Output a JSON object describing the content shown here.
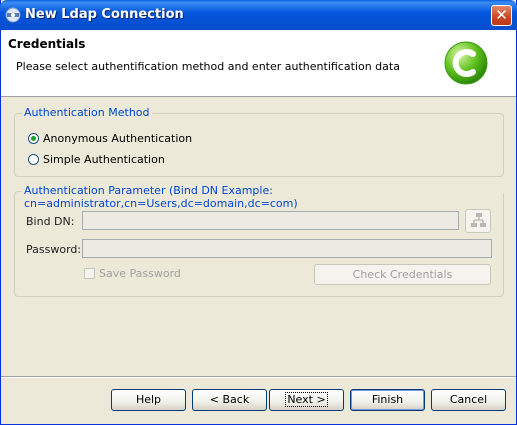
{
  "window": {
    "title": "New Ldap Connection",
    "close_icon": "close-icon"
  },
  "header": {
    "title": "Credentials",
    "description": "Please select authentification method and enter authentification data"
  },
  "auth_method": {
    "legend": "Authentication Method",
    "options": [
      {
        "label": "Anonymous Authentication",
        "selected": true
      },
      {
        "label": "Simple Authentication",
        "selected": false
      }
    ]
  },
  "auth_params": {
    "legend": "Authentication Parameter (Bind DN Example: cn=administrator,cn=Users,dc=domain,dc=com)",
    "bind_dn_label": "Bind DN:",
    "bind_dn_value": "",
    "password_label": "Password:",
    "password_value": "",
    "save_password_label": "Save Password",
    "check_credentials_label": "Check Credentials"
  },
  "buttons": {
    "help": "Help",
    "back": "< Back",
    "next": "Next >",
    "finish": "Finish",
    "cancel": "Cancel"
  },
  "colors": {
    "accent": "#0046d5",
    "titlebar": "#0859e0",
    "close": "#c9461f",
    "radio_dot": "#21a121"
  }
}
